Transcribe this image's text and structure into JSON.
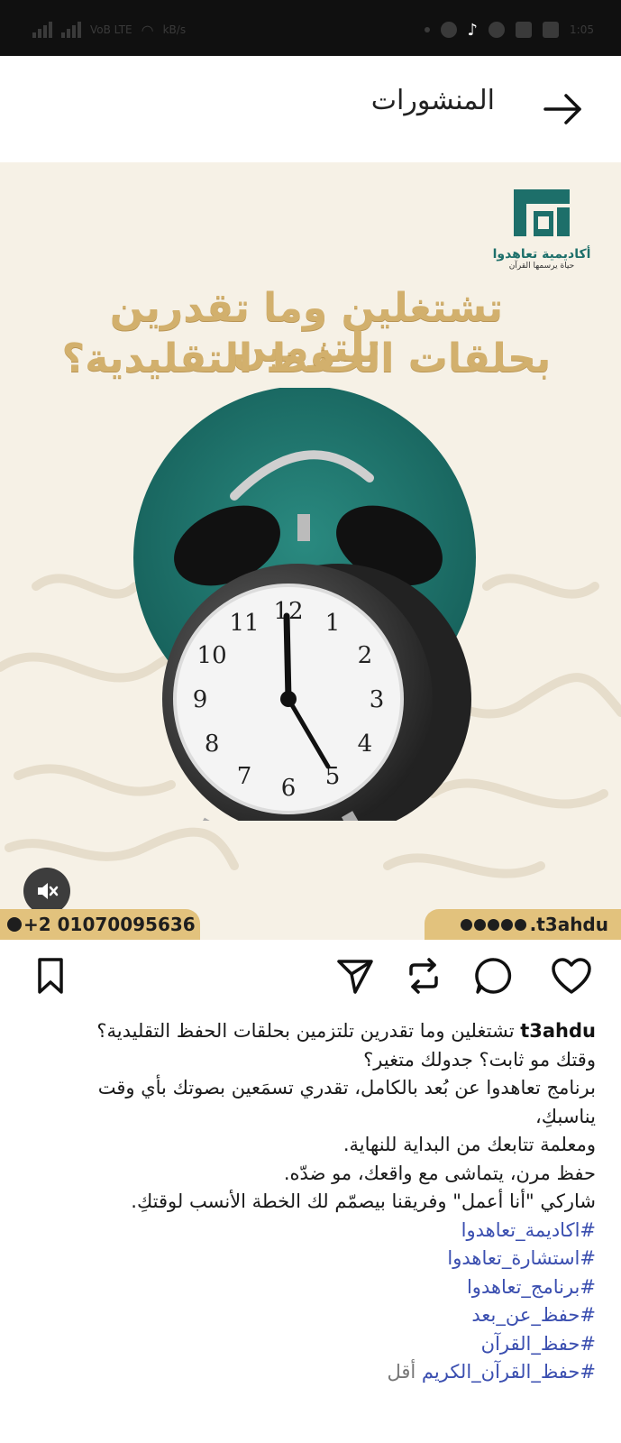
{
  "status_bar": {
    "carrier": "VoB LTE",
    "network_speed": "kB/s",
    "time": "1:05"
  },
  "header": {
    "title": "المنشورات"
  },
  "post_image": {
    "logo_name": "أكاديمية تعاهدوا",
    "logo_tagline": "حياة يرسمها القرآن",
    "headline_line1": "تشتغلين وما تقدرين تلتزمين",
    "headline_line2": "بحلقات الحفظ التقليدية؟",
    "clock_numbers": [
      "12",
      "1",
      "2",
      "3",
      "4",
      "5",
      "6",
      "7",
      "8",
      "9",
      "10",
      "11"
    ],
    "phone": "+2 01070095636",
    "handle": ".t3ahdu"
  },
  "caption": {
    "username": "t3ahdu",
    "line1_text": "تشتغلين وما تقدرين تلتزمين بحلقات الحفظ التقليدية؟",
    "line2": "وقتك مو ثابت؟ جدولك متغير؟",
    "line3": "برنامج تعاهدوا عن بُعد بالكامل، تقدري تسمَعين بصوتك بأي وقت",
    "line4": "يناسبكِ،",
    "line5": " ومعلمة تتابعك من البداية للنهاية.",
    "line6": "حفظ مرن، يتماشى مع واقعك، مو ضدّه.",
    "line7": "شاركي \"أنا أعمل\" وفريقنا بيصمّم لك الخطة الأنسب لوقتكِ.",
    "hashtags": [
      "#اكاديمة_تعاهدوا",
      "#استشارة_تعاهدوا",
      "#برنامج_تعاهدوا",
      "#حفظ_عن_بعد",
      "#حفظ_القرآن",
      "#حفظ_القرآن_الكريم"
    ],
    "more_label": "أقل"
  }
}
